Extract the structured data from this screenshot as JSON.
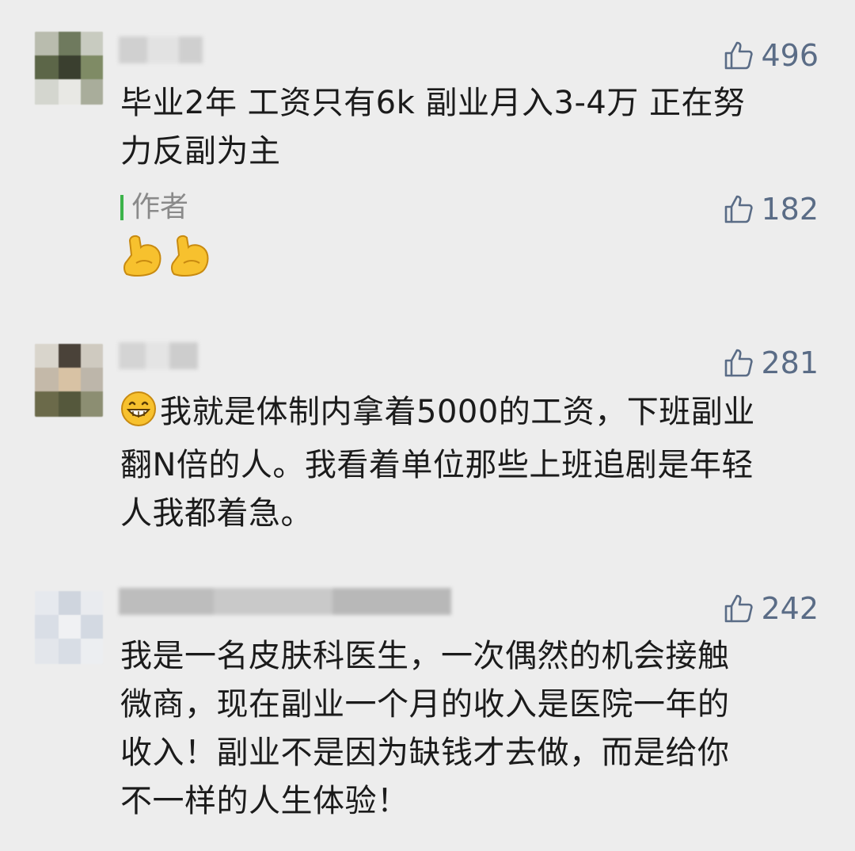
{
  "comments": [
    {
      "likes": "496",
      "lines": [
        "毕业2年 工资只有6k 副业月入3-4万  正在努",
        "力反副为主"
      ],
      "author_reply": {
        "tag": "作者",
        "likes": "182",
        "emoji": [
          "flexed-biceps-icon",
          "flexed-biceps-icon"
        ]
      }
    },
    {
      "likes": "281",
      "prefix_emoji": "grinning-face-icon",
      "lines": [
        "我就是体制内拿着5000的工资，下班副业",
        "翻N倍的人。我看着单位那些上班追剧是年轻",
        "人我都着急。"
      ]
    },
    {
      "likes": "242",
      "lines": [
        "我是一名皮肤科医生，一次偶然的机会接触",
        "微商，现在副业一个月的收入是医院一年的",
        "收入！副业不是因为缺钱才去做，而是给你",
        "不一样的人生体验！"
      ]
    }
  ],
  "colors": {
    "background": "#ededed",
    "like_color": "#5a6c86",
    "author_bar": "#3cb34a"
  }
}
